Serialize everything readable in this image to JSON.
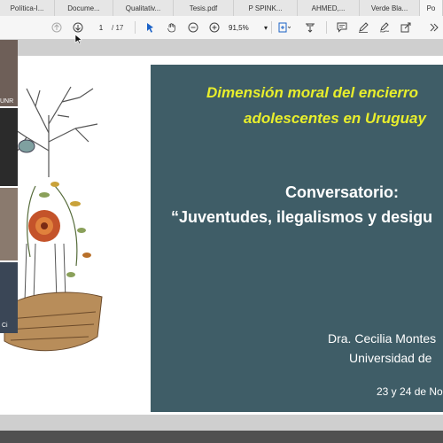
{
  "tabs": [
    {
      "label": "Política-I..."
    },
    {
      "label": "Docume..."
    },
    {
      "label": "Qualitativ..."
    },
    {
      "label": "Tesis.pdf"
    },
    {
      "label": "P SPINK..."
    },
    {
      "label": "AHMED,..."
    },
    {
      "label": "Verde Bla..."
    },
    {
      "label": "Po"
    }
  ],
  "toolbar": {
    "page_current": "1",
    "page_total": "/ 17",
    "zoom": "91,5%"
  },
  "slide": {
    "title_line1": "Dimensión moral del encierro",
    "title_line2": "adolescentes en Uruguay",
    "event_label": "Conversatorio:",
    "event_title": "“Juventudes, ilegalismos y desigu",
    "author": "Dra. Cecilia Montes",
    "institution": "Universidad de",
    "date": "23 y 24 de No"
  },
  "participants": [
    {
      "label": "UNR"
    },
    {
      "label": "Ci"
    }
  ],
  "colors": {
    "panel": "#3f5d67",
    "title": "#e8ee2c",
    "text": "#ffffff"
  }
}
